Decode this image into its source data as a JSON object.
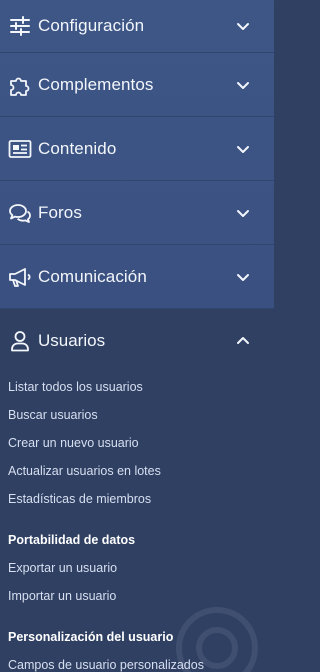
{
  "sidebar": {
    "sections": [
      {
        "label": "Configuración",
        "icon": "sliders-icon"
      },
      {
        "label": "Complementos",
        "icon": "puzzle-icon"
      },
      {
        "label": "Contenido",
        "icon": "newspaper-icon"
      },
      {
        "label": "Foros",
        "icon": "chat-bubbles-icon"
      },
      {
        "label": "Comunicación",
        "icon": "megaphone-icon"
      }
    ],
    "active": {
      "label": "Usuarios",
      "icon": "user-icon",
      "items": [
        "Listar todos los usuarios",
        "Buscar usuarios",
        "Crear un nuevo usuario",
        "Actualizar usuarios en lotes",
        "Estadísticas de miembros"
      ],
      "groups": [
        {
          "heading": "Portabilidad de datos",
          "items": [
            "Exportar un usuario",
            "Importar un usuario"
          ]
        },
        {
          "heading": "Personalización del usuario",
          "items": [
            "Campos de usuario personalizados"
          ]
        }
      ]
    }
  },
  "colors": {
    "collapsed_bg": "#3e5787",
    "active_bg": "#2f4063",
    "text": "#f3f6fb",
    "subtext": "#d8dff0"
  }
}
